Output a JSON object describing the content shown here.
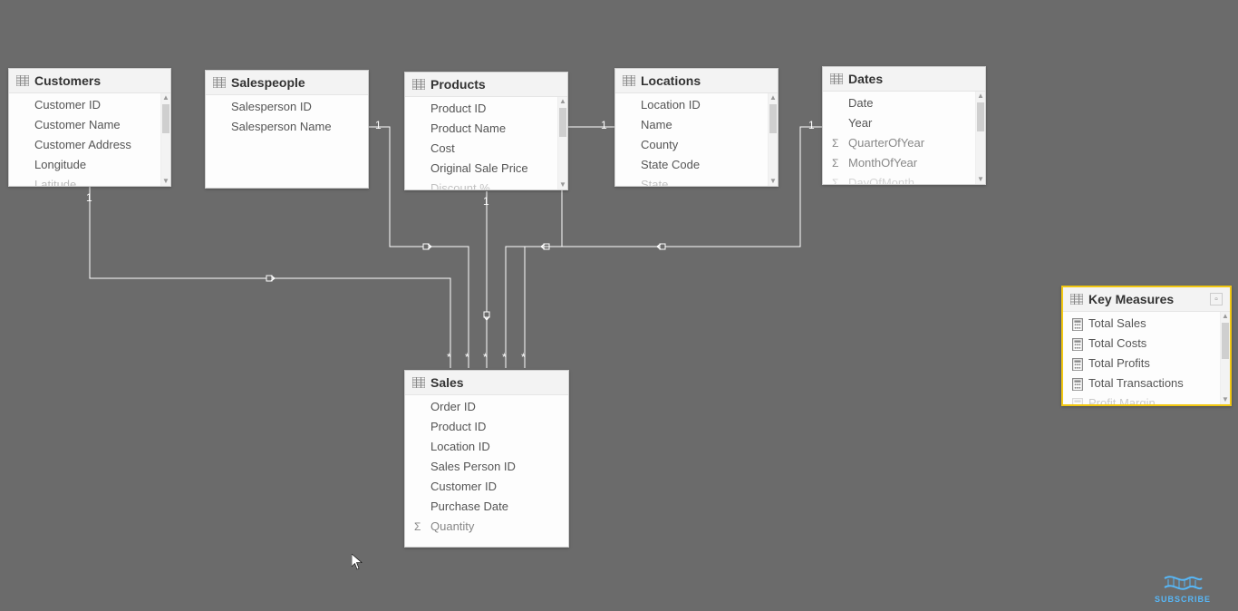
{
  "tables": {
    "customers": {
      "title": "Customers",
      "columns": [
        "Customer ID",
        "Customer Name",
        "Customer Address",
        "Longitude",
        "Latitude"
      ],
      "scrollable": true
    },
    "salespeople": {
      "title": "Salespeople",
      "columns": [
        "Salesperson ID",
        "Salesperson Name"
      ],
      "scrollable": false
    },
    "products": {
      "title": "Products",
      "columns": [
        "Product ID",
        "Product Name",
        "Cost",
        "Original Sale Price",
        "Discount %..."
      ],
      "scrollable": true
    },
    "locations": {
      "title": "Locations",
      "columns": [
        "Location ID",
        "Name",
        "County",
        "State Code",
        "State"
      ],
      "scrollable": true
    },
    "dates": {
      "title": "Dates",
      "columns": [
        "Date",
        "Year",
        "QuarterOfYear",
        "MonthOfYear",
        "DayOfMonth"
      ],
      "sigma_on": [
        2,
        3,
        4
      ],
      "scrollable": true
    },
    "sales": {
      "title": "Sales",
      "columns": [
        "Order ID",
        "Product ID",
        "Location ID",
        "Sales Person ID",
        "Customer ID",
        "Purchase Date",
        "Quantity"
      ],
      "sigma_on": [
        6
      ],
      "scrollable": false
    },
    "key_measures": {
      "title": "Key Measures",
      "selected": true,
      "measures": [
        "Total Sales",
        "Total Costs",
        "Total Profits",
        "Total Transactions",
        "Profit Margin"
      ],
      "scrollable": true
    }
  },
  "relationships": {
    "customers_to_sales": {
      "one": "1",
      "many": "*"
    },
    "salespeople_to_sales": {
      "one": "1",
      "many": "*"
    },
    "products_to_sales": {
      "one": "1",
      "many": "*"
    },
    "locations_to_sales": {
      "one": "1",
      "many": "*"
    },
    "dates_to_sales": {
      "one": "1",
      "many": "*"
    }
  },
  "watermark": "SUBSCRIBE"
}
